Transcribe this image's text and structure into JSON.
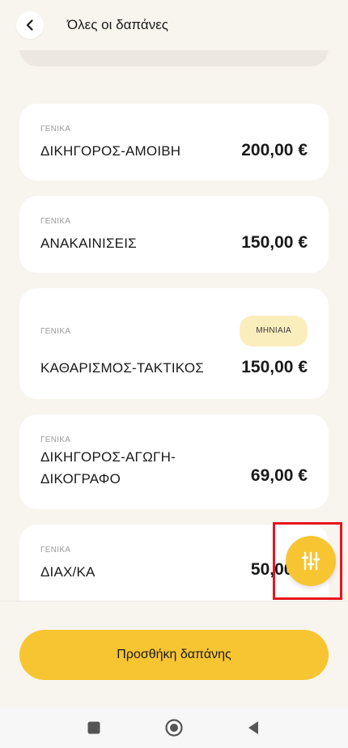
{
  "header": {
    "title": "Όλες οι δαπάνες"
  },
  "expenses": [
    {
      "category": "ΓΕΝΙΚΑ",
      "name": "ΔΙΚΗΓΟΡΟΣ-ΑΜΟΙΒΗ",
      "amount": "200,00 €"
    },
    {
      "category": "ΓΕΝΙΚΑ",
      "name": "ΑΝΑΚΑΙΝΙΣΕΙΣ",
      "amount": "150,00 €"
    },
    {
      "category": "ΓΕΝΙΚΑ",
      "name": "ΚΑΘΑΡΙΣΜΟΣ-ΤΑΚΤΙΚΟΣ",
      "amount": "150,00 €",
      "badge": "ΜΗΝΙΑΙΑ"
    },
    {
      "category": "ΓΕΝΙΚΑ",
      "name_line1": "ΔΙΚΗΓΟΡΟΣ-ΑΓΩΓΗ-",
      "name_line2": "ΔΙΚΟΓΡΑΦΟ",
      "amount": "69,00 €"
    },
    {
      "category": "ΓΕΝΙΚΑ",
      "name": "ΔΙΑΧ/ΚΑ",
      "amount": "50,00 €"
    }
  ],
  "add_button": {
    "label": "Προσθήκη δαπάνης"
  },
  "colors": {
    "accent": "#f7c532",
    "background": "#f8f5ef",
    "card": "#ffffff",
    "badge_bg": "#fbeebd",
    "highlight": "#e5161d"
  },
  "icons": {
    "back": "chevron-left-icon",
    "filter": "sliders-icon",
    "nav_recent": "square-icon",
    "nav_home": "circle-icon",
    "nav_back": "triangle-back-icon"
  }
}
